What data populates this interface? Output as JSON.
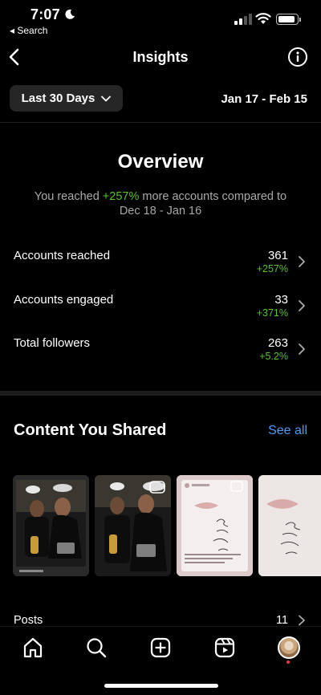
{
  "status_bar": {
    "time": "7:07",
    "back_app": "◂ Search"
  },
  "header": {
    "title": "Insights"
  },
  "filter": {
    "range_label": "Last 30 Days",
    "date_range": "Jan 17 - Feb 15"
  },
  "overview": {
    "title": "Overview",
    "desc_prefix": "You reached ",
    "desc_pct": "+257%",
    "desc_suffix": " more accounts compared to",
    "desc_dates": "Dec 18 - Jan 16",
    "metrics": [
      {
        "label": "Accounts reached",
        "value": "361",
        "change": "+257%"
      },
      {
        "label": "Accounts engaged",
        "value": "33",
        "change": "+371%"
      },
      {
        "label": "Total followers",
        "value": "263",
        "change": "+5.2%"
      }
    ]
  },
  "content_shared": {
    "title": "Content You Shared",
    "see_all": "See all",
    "thumbnails": [
      {
        "kind": "dark-photo"
      },
      {
        "kind": "dark-photo"
      },
      {
        "kind": "light-card"
      },
      {
        "kind": "light-card"
      }
    ]
  },
  "posts": {
    "label": "Posts",
    "count": "11"
  },
  "tab_bar": {
    "items": [
      "home-icon",
      "search-icon",
      "create-icon",
      "reels-icon",
      "profile-avatar"
    ]
  },
  "colors": {
    "accent_green": "#58c322",
    "link_blue": "#4a9cf4",
    "background": "#000000"
  }
}
